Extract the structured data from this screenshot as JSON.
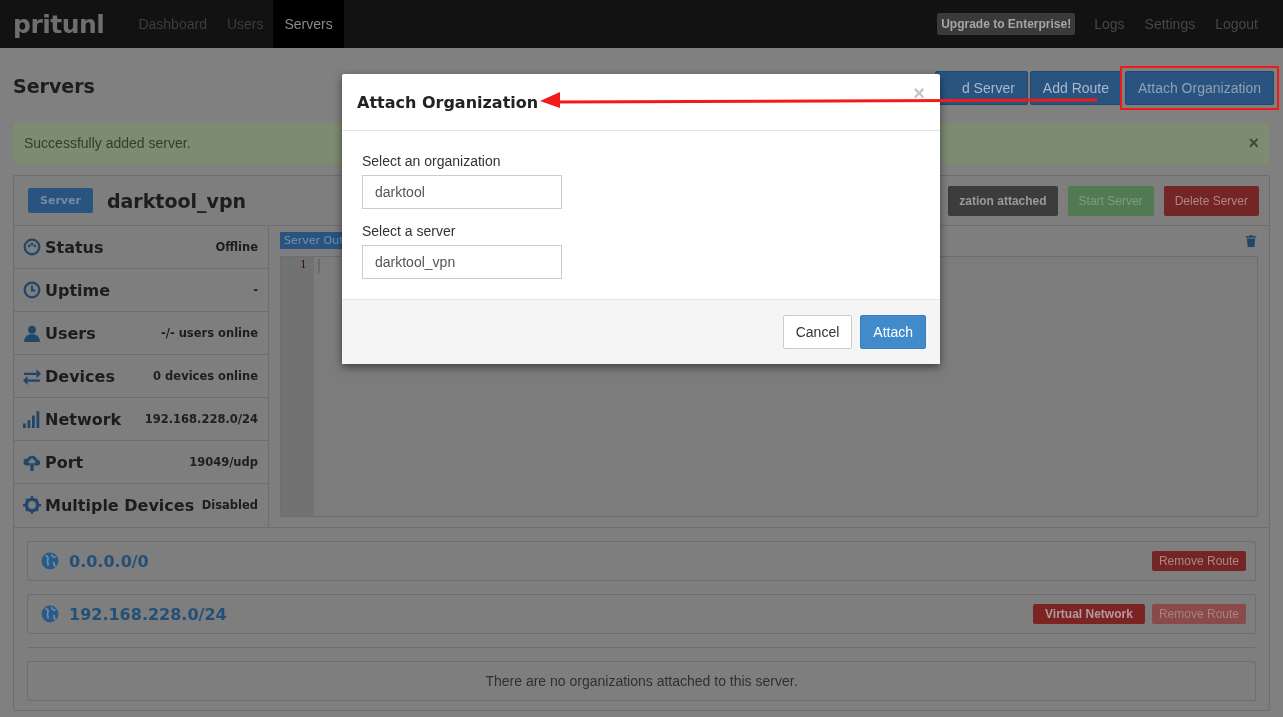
{
  "navbar": {
    "logo": "pritunl",
    "links": [
      {
        "label": "Dashboard",
        "selected": false
      },
      {
        "label": "Users",
        "selected": false
      },
      {
        "label": "Servers",
        "selected": true
      }
    ],
    "upgrade": "Upgrade to Enterprise!",
    "right_links": [
      "Logs",
      "Settings",
      "Logout"
    ]
  },
  "page": {
    "title": "Servers",
    "buttons": [
      {
        "label": "d Server",
        "highlighted": false
      },
      {
        "label": "Add Route",
        "highlighted": false
      },
      {
        "label": "Attach Organization",
        "highlighted": true
      }
    ]
  },
  "alert": {
    "message": "Successfully added server.",
    "close": "×"
  },
  "server": {
    "badge": "Server",
    "name": "darktool_vpn",
    "buttons": [
      {
        "label": "zation attached",
        "kind": "dark"
      },
      {
        "label": "Start Server",
        "kind": "success"
      },
      {
        "label": "Delete Server",
        "kind": "danger"
      }
    ],
    "info": [
      {
        "kind": "status",
        "label": "Status",
        "value": "Offline"
      },
      {
        "kind": "uptime",
        "label": "Uptime",
        "value": "-"
      },
      {
        "kind": "users",
        "label": "Users",
        "value": "-/- users online"
      },
      {
        "kind": "devices",
        "label": "Devices",
        "value": "0 devices online"
      },
      {
        "kind": "network",
        "label": "Network",
        "value": "192.168.228.0/24"
      },
      {
        "kind": "port",
        "label": "Port",
        "value": "19049/udp"
      },
      {
        "kind": "multi",
        "label": "Multiple Devices",
        "value": "Disabled"
      }
    ],
    "output": {
      "tab": "Server Out",
      "line_numbers": [
        "1"
      ]
    }
  },
  "routes": [
    {
      "network": "0.0.0.0/0",
      "buttons": [
        {
          "label": "Remove Route",
          "kind": "remove",
          "disabled": false
        }
      ]
    },
    {
      "network": "192.168.228.0/24",
      "buttons": [
        {
          "label": "Virtual Network",
          "kind": "vnet",
          "disabled": false
        },
        {
          "label": "Remove Route",
          "kind": "remove",
          "disabled": true
        }
      ]
    }
  ],
  "organizations_empty": "There are no organizations attached to this server.",
  "modal": {
    "title": "Attach Organization",
    "close": "×",
    "fields": [
      {
        "label": "Select an organization",
        "value": "darktool"
      },
      {
        "label": "Select a server",
        "value": "darktool_vpn"
      }
    ],
    "buttons": [
      {
        "label": "Cancel",
        "kind": "default"
      },
      {
        "label": "Attach",
        "kind": "primary"
      }
    ]
  }
}
